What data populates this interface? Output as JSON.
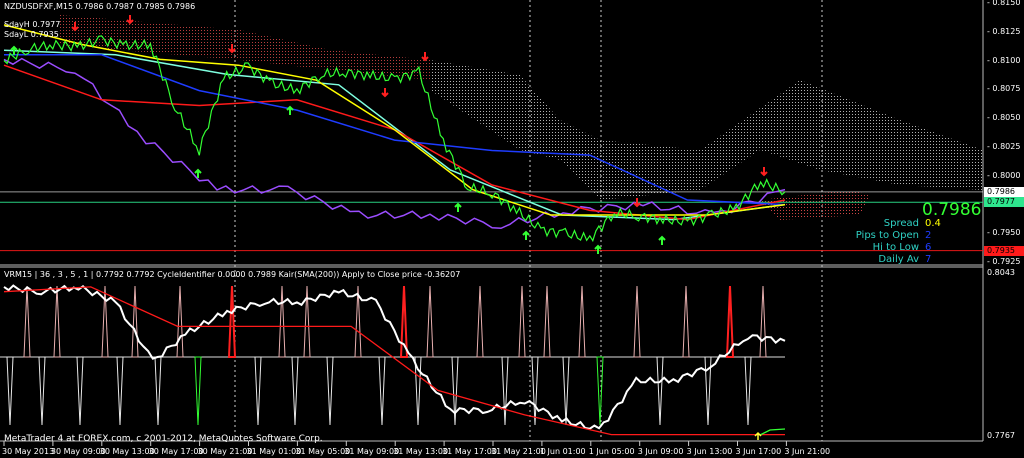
{
  "header": {
    "symbol_line": "NZDUSDFXF,M15  0.7986 0.7987 0.7985 0.7986",
    "sday_high": "SdayH 0.7977",
    "sday_low": "SdayL 0.7935"
  },
  "sub_header": "VRM15 | 36 , 3 , 5 , 1 | 0.7792 0.7792  CycleIdentifier 0.0000 0.7989  Kair(SMA(200)) Apply to Close price -0.36207",
  "footer": "MetaTrader 4 at FOREX.com, c 2001-2012, MetaQuotes Software Corp.",
  "info_panel": {
    "price": "0.7986",
    "rows": [
      {
        "label": "Spread",
        "value": "0.4",
        "color": "#ffff00"
      },
      {
        "label": "Pips to Open",
        "value": "2",
        "color": "#1e3cff"
      },
      {
        "label": "Hi to Low",
        "value": "6",
        "color": "#1e3cff"
      },
      {
        "label": "Daily Av",
        "value": "7",
        "color": "#1e3cff"
      }
    ]
  },
  "price_axis": [
    "0.8150",
    "0.8125",
    "0.8100",
    "0.8075",
    "0.8050",
    "0.8025",
    "0.8000",
    "0.7950",
    "0.7925"
  ],
  "price_markers": {
    "bid": {
      "label": "0.7986",
      "value": 0.7986,
      "color": "#ffffff"
    },
    "sday_high": {
      "label": "0.7977",
      "value": 0.7977,
      "color": "#2ee68e"
    },
    "sday_low": {
      "label": "0.7935",
      "value": 0.7935,
      "color": "#ff1a1a"
    }
  },
  "lower_axis": [
    "0.8043",
    "0.7767"
  ],
  "chart_data": {
    "type": "line",
    "title": "NZDUSDFXF,M15",
    "time_labels": [
      "30 May 2013",
      "30 May 09:00",
      "30 May 13:00",
      "30 May 17:00",
      "30 May 21:00",
      "31 May 01:00",
      "31 May 05:00",
      "31 May 09:00",
      "31 May 13:00",
      "31 May 17:00",
      "31 May 21:00",
      "1 Jun 01:00",
      "1 Jun 05:00",
      "3 Jun 09:00",
      "3 Jun 13:00",
      "3 Jun 17:00",
      "3 Jun 21:00"
    ],
    "ylim": [
      0.7915,
      0.8152
    ],
    "series": [
      {
        "name": "Close",
        "color": "#33ff33",
        "values": [
          0.81,
          0.811,
          0.8114,
          0.8112,
          0.8118,
          0.8113,
          0.8114,
          0.806,
          0.8022,
          0.8085,
          0.8095,
          0.808,
          0.8074,
          0.8088,
          0.809,
          0.8087,
          0.8084,
          0.809,
          0.803,
          0.799,
          0.7985,
          0.797,
          0.7953,
          0.795,
          0.7945,
          0.7968,
          0.7965,
          0.7962,
          0.796,
          0.7966,
          0.7972,
          0.7995,
          0.7986
        ]
      },
      {
        "name": "MA yellow",
        "color": "#ffff00",
        "values": [
          0.8131,
          0.8114,
          0.8101,
          0.8096,
          0.8083,
          0.804,
          0.7988,
          0.7966,
          0.7966,
          0.7966,
          0.7975
        ]
      },
      {
        "name": "MA blue",
        "color": "#1e3cff",
        "values": [
          0.8105,
          0.8105,
          0.8074,
          0.8057,
          0.8031,
          0.8022,
          0.8018,
          0.7979,
          0.7975
        ]
      },
      {
        "name": "MA red",
        "color": "#ff1a1a",
        "values": [
          0.8096,
          0.8066,
          0.8061,
          0.8066,
          0.804,
          0.7992,
          0.797,
          0.7962,
          0.7979
        ]
      },
      {
        "name": "MA cyan",
        "color": "#7fffe0",
        "values": [
          0.8109,
          0.8105,
          0.8088,
          0.8079,
          0.8005,
          0.7966,
          0.7962,
          0.7975
        ]
      },
      {
        "name": "Purple",
        "color": "#9b4dff",
        "values": [
          0.8101,
          0.8092,
          0.8031,
          0.7988,
          0.7988,
          0.7966,
          0.7966,
          0.7957,
          0.797,
          0.7975,
          0.7966,
          0.7988
        ]
      }
    ],
    "lower_pane": {
      "ylim": [
        0.7767,
        0.8043
      ],
      "series": [
        {
          "name": "Oscillator",
          "color": "#ffffff",
          "values": [
            0.8018,
            0.801,
            0.8018,
            0.7993,
            0.7894,
            0.7944,
            0.7977,
            0.7993,
            0.7993,
            0.801,
            0.7993,
            0.7894,
            0.7812,
            0.7812,
            0.7828,
            0.7795,
            0.7779,
            0.7861,
            0.7861,
            0.7886,
            0.7936,
            0.7928
          ]
        },
        {
          "name": "Kair SMA",
          "color": "#ff1a1a",
          "values": [
            0.801,
            0.8018,
            0.7952,
            0.7952,
            0.7952,
            0.7845,
            0.7804,
            0.7771,
            0.7771,
            0.7771
          ]
        }
      ]
    }
  }
}
